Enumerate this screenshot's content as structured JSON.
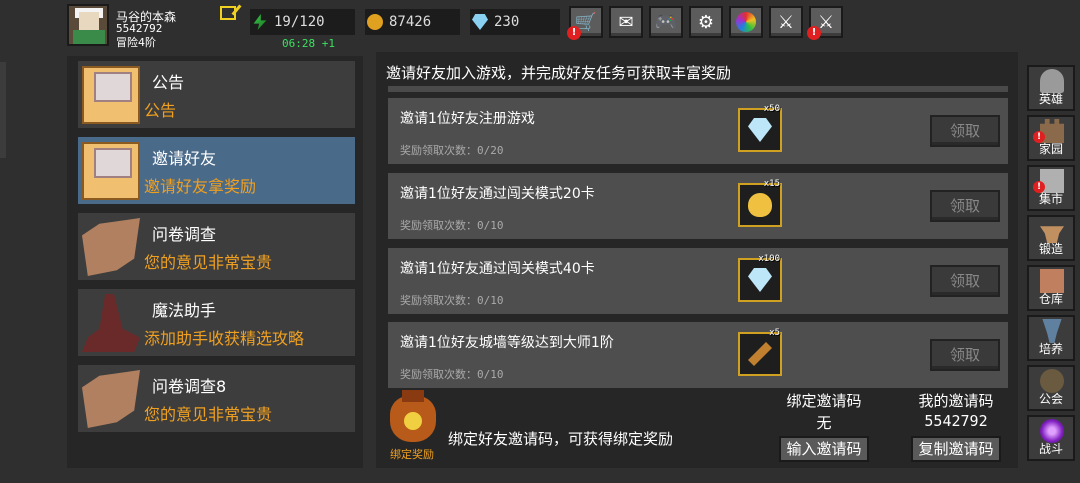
{
  "player": {
    "name": "马谷的本森",
    "id": "5542792",
    "rank": "冒险4阶",
    "energy": "19/120",
    "energy_timer": "06:28 +1",
    "gold": "87426",
    "gems": "230"
  },
  "top_buttons": [
    {
      "icon": "shop-cart-icon",
      "badge": "!"
    },
    {
      "icon": "mail-icon"
    },
    {
      "icon": "gamepad-icon"
    },
    {
      "icon": "gear-icon"
    },
    {
      "icon": "color-wheel-icon"
    },
    {
      "icon": "weapon-icon"
    },
    {
      "icon": "crossed-swords-icon",
      "badge": "!"
    }
  ],
  "notices": [
    {
      "title": "公告",
      "subtitle": "公告",
      "icon": "envelope-icon"
    },
    {
      "title": "邀请好友",
      "subtitle": "邀请好友拿奖励",
      "icon": "envelope-icon",
      "active": true
    },
    {
      "title": "问卷调查",
      "subtitle": "您的意见非常宝贵",
      "icon": "scroll-icon"
    },
    {
      "title": "魔法助手",
      "subtitle": "添加助手收获精选攻略",
      "icon": "wizard-hat-icon"
    },
    {
      "title": "问卷调查8",
      "subtitle": "您的意见非常宝贵",
      "icon": "scroll-icon"
    }
  ],
  "main": {
    "header": "邀请好友加入游戏，并完成好友任务可获取丰富奖励",
    "count_label": "奖励领取次数：",
    "tasks": [
      {
        "name": "邀请1位好友注册游戏",
        "count": "0/20",
        "reward_icon": "diamond-icon",
        "reward_qty": "x50",
        "claim": "领取"
      },
      {
        "name": "邀请1位好友通过闯关模式20卡",
        "count": "0/10",
        "reward_icon": "egg-icon",
        "reward_qty": "x15",
        "claim": "领取"
      },
      {
        "name": "邀请1位好友通过闯关模式40卡",
        "count": "0/10",
        "reward_icon": "diamond-icon",
        "reward_qty": "x100",
        "claim": "领取"
      },
      {
        "name": "邀请1位好友城墙等级达到大师1阶",
        "count": "0/10",
        "reward_icon": "staff-icon",
        "reward_qty": "x5",
        "claim": "领取"
      }
    ],
    "bind": {
      "icon_label": "绑定奖励",
      "text": "绑定好友邀请码，可获得绑定奖励",
      "bound_title": "绑定邀请码",
      "bound_value": "无",
      "bound_button": "输入邀请码",
      "my_title": "我的邀请码",
      "my_value": "5542792",
      "my_button": "复制邀请码"
    }
  },
  "sidebar": [
    {
      "label": "英雄",
      "icon": "helmet-icon"
    },
    {
      "label": "家园",
      "icon": "castle-icon",
      "badge": "!"
    },
    {
      "label": "集市",
      "icon": "market-icon",
      "badge": "!"
    },
    {
      "label": "锻造",
      "icon": "anvil-icon"
    },
    {
      "label": "仓库",
      "icon": "warehouse-icon"
    },
    {
      "label": "培养",
      "icon": "trophy-icon"
    },
    {
      "label": "公会",
      "icon": "guild-icon"
    },
    {
      "label": "战斗",
      "icon": "portal-icon"
    }
  ]
}
